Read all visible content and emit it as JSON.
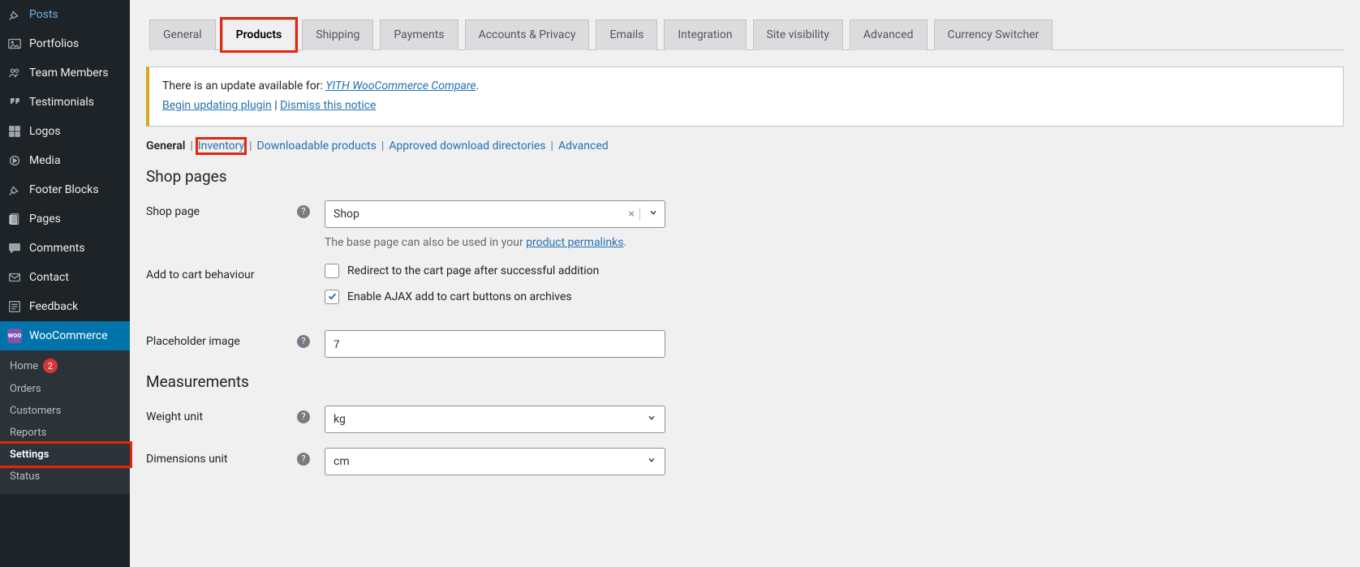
{
  "sidebar": {
    "items": [
      {
        "label": "Posts"
      },
      {
        "label": "Portfolios"
      },
      {
        "label": "Team Members"
      },
      {
        "label": "Testimonials"
      },
      {
        "label": "Logos"
      },
      {
        "label": "Media"
      },
      {
        "label": "Footer Blocks"
      },
      {
        "label": "Pages"
      },
      {
        "label": "Comments"
      },
      {
        "label": "Contact"
      },
      {
        "label": "Feedback"
      },
      {
        "label": "WooCommerce"
      }
    ],
    "home_badge": "2",
    "submenu": [
      {
        "label": "Home"
      },
      {
        "label": "Orders"
      },
      {
        "label": "Customers"
      },
      {
        "label": "Reports"
      },
      {
        "label": "Settings"
      },
      {
        "label": "Status"
      }
    ]
  },
  "tabs": [
    "General",
    "Products",
    "Shipping",
    "Payments",
    "Accounts & Privacy",
    "Emails",
    "Integration",
    "Site visibility",
    "Advanced",
    "Currency Switcher"
  ],
  "notice": {
    "text_before": "There is an update available for: ",
    "plugin": "YITH WooCommerce Compare",
    "begin": "Begin updating plugin",
    "dismiss": "Dismiss this notice"
  },
  "subsections": [
    "General",
    "Inventory",
    "Downloadable products",
    "Approved download directories",
    "Advanced"
  ],
  "section_shop": "Shop pages",
  "section_meas": "Measurements",
  "labels": {
    "shop_page": "Shop page",
    "add_to_cart": "Add to cart behaviour",
    "placeholder_image": "Placeholder image",
    "weight_unit": "Weight unit",
    "dim_unit": "Dimensions unit"
  },
  "values": {
    "shop_page": "Shop",
    "shop_page_desc_prefix": "The base page can also be used in your ",
    "shop_page_desc_link": "product permalinks",
    "cb_redirect": "Redirect to the cart page after successful addition",
    "cb_ajax": "Enable AJAX add to cart buttons on archives",
    "placeholder_image": "7",
    "weight_unit": "kg",
    "dim_unit": "cm"
  }
}
